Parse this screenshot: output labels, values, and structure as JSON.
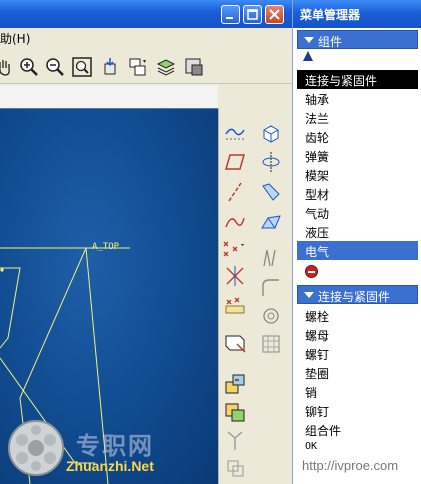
{
  "menubar": {
    "help_label": "助(H)"
  },
  "canvas": {
    "datum_label": "A_TOP"
  },
  "menu_manager": {
    "title": "菜单管理器",
    "group1_header": "组件",
    "group1_items": [
      "连接与紧固件",
      "轴承",
      "法兰",
      "齿轮",
      "弹簧",
      "模架",
      "型材",
      "气动",
      "液压",
      "电气"
    ],
    "group1_selected_index": 0,
    "group1_highlight_index": 9,
    "group2_header": "连接与紧固件",
    "group2_items": [
      "螺栓",
      "螺母",
      "螺钉",
      "垫圈",
      "销",
      "铆钉",
      "组合件",
      "OK"
    ]
  },
  "watermarks": {
    "left_big": "专职网",
    "left": "Zhuanzhi.Net",
    "right": "http://ivproe.com"
  },
  "colors": {
    "titlebar": "#1c5fd8",
    "canvas_bg": "#104a8f",
    "selection": "#000000",
    "highlight": "#3b6fd0",
    "datum": "#f2f27a"
  },
  "icons": {
    "window": [
      "minimize-icon",
      "maximize-icon",
      "close-icon"
    ],
    "toolbar": [
      "pan-icon",
      "zoom-in-icon",
      "zoom-out-icon",
      "zoom-fit-icon",
      "reorient-icon",
      "saved-views-icon",
      "layers-icon",
      "model-display-icon"
    ],
    "side_toolbar": [
      "sketch-icon",
      "extrude-icon",
      "datum-plane-icon",
      "revolve-icon",
      "datum-axis-icon",
      "sweep-icon",
      "datum-curve-icon",
      "blend-icon",
      "datum-point-icon",
      "draft-icon",
      "coordinate-system-icon",
      "round-icon",
      "analysis-feature-icon",
      "shell-icon",
      "component-icon",
      "pattern-icon",
      "assemble-icon",
      "mirror-icon",
      "create-component-icon",
      "merge-icon"
    ]
  }
}
